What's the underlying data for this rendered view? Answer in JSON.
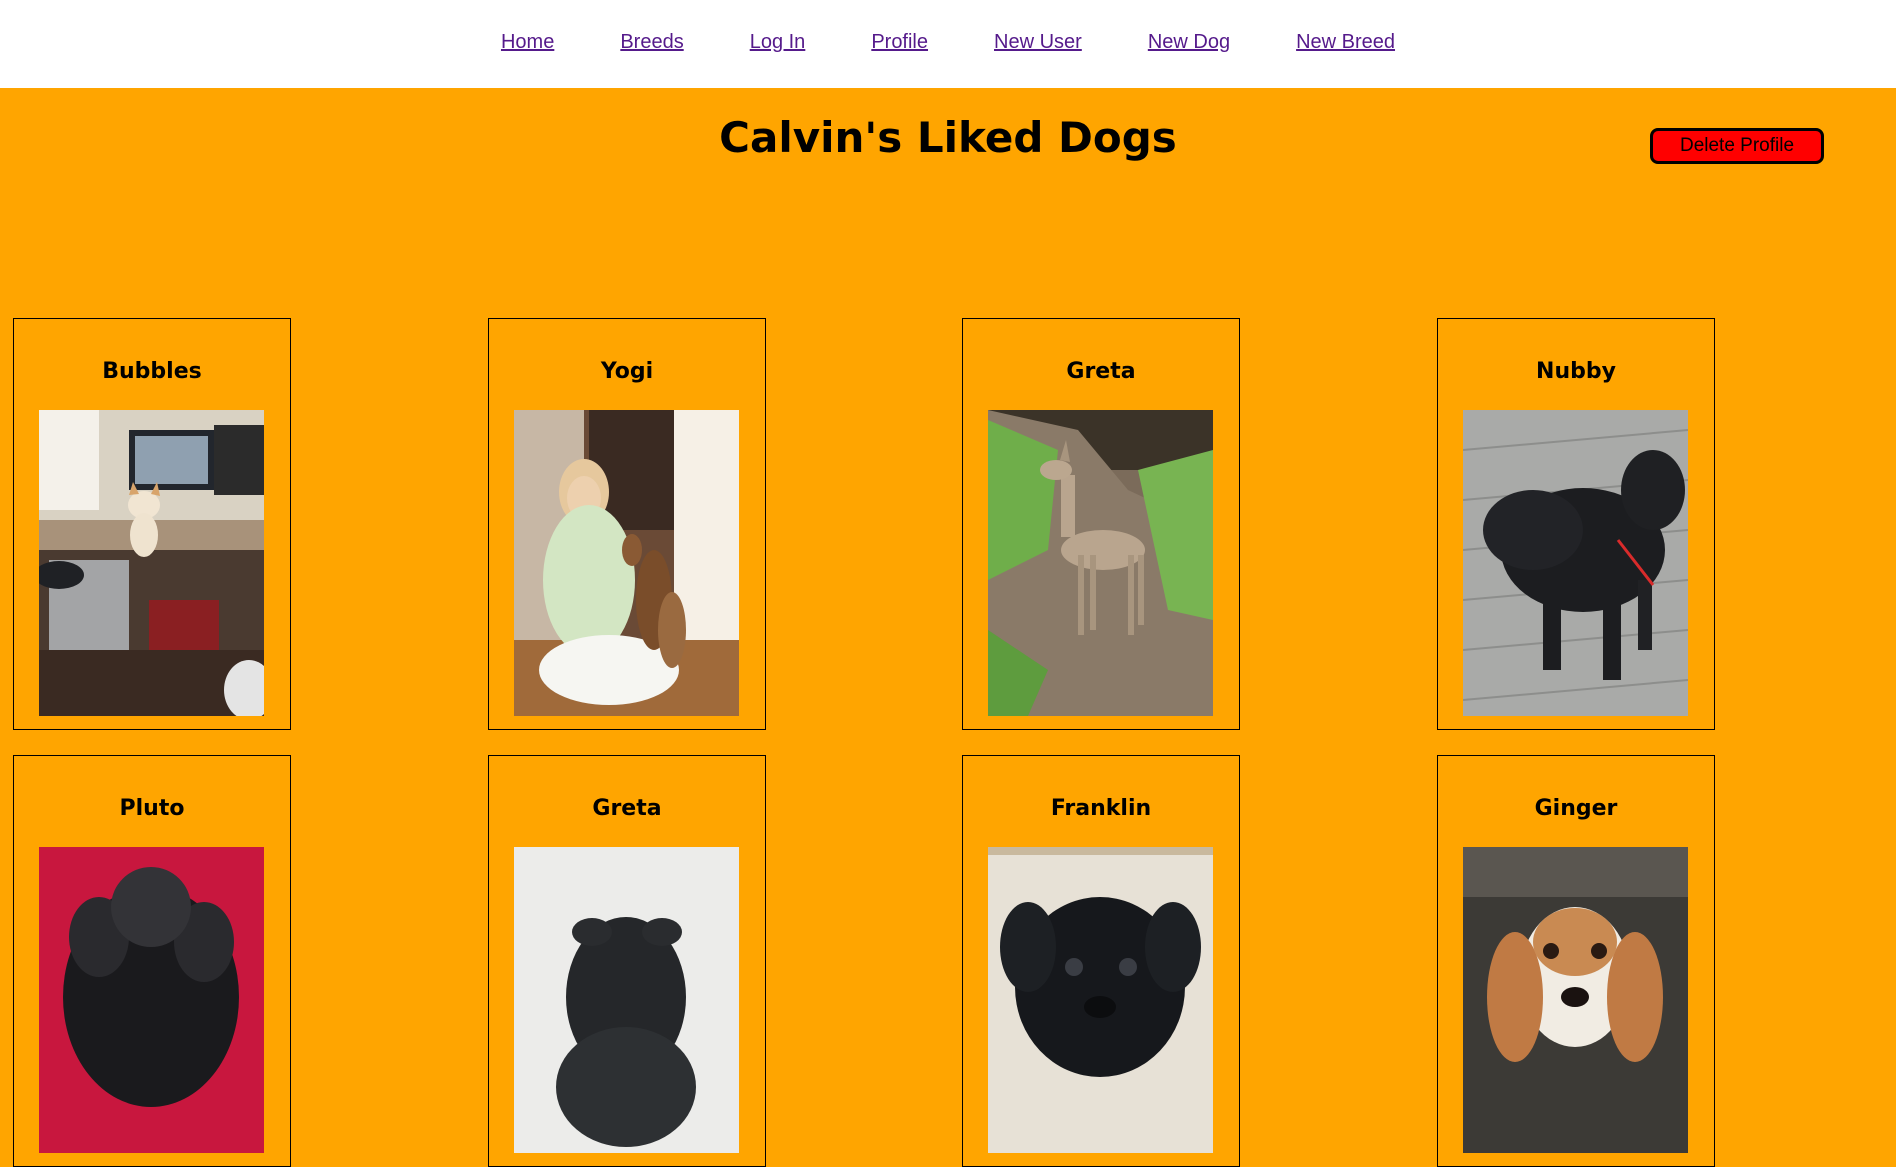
{
  "nav": {
    "items": [
      {
        "label": "Home"
      },
      {
        "label": "Breeds"
      },
      {
        "label": "Log In"
      },
      {
        "label": "Profile"
      },
      {
        "label": "New User"
      },
      {
        "label": "New Dog"
      },
      {
        "label": "New Breed"
      }
    ]
  },
  "page": {
    "title": "Calvin's Liked Dogs",
    "delete_button": "Delete Profile"
  },
  "dogs": [
    {
      "name": "Bubbles"
    },
    {
      "name": "Yogi"
    },
    {
      "name": "Greta"
    },
    {
      "name": "Nubby"
    },
    {
      "name": "Pluto"
    },
    {
      "name": "Greta"
    },
    {
      "name": "Franklin"
    },
    {
      "name": "Ginger"
    }
  ],
  "colors": {
    "page_background": "#ffa500",
    "delete_button": "#ff0000",
    "link": "#551a8b"
  }
}
